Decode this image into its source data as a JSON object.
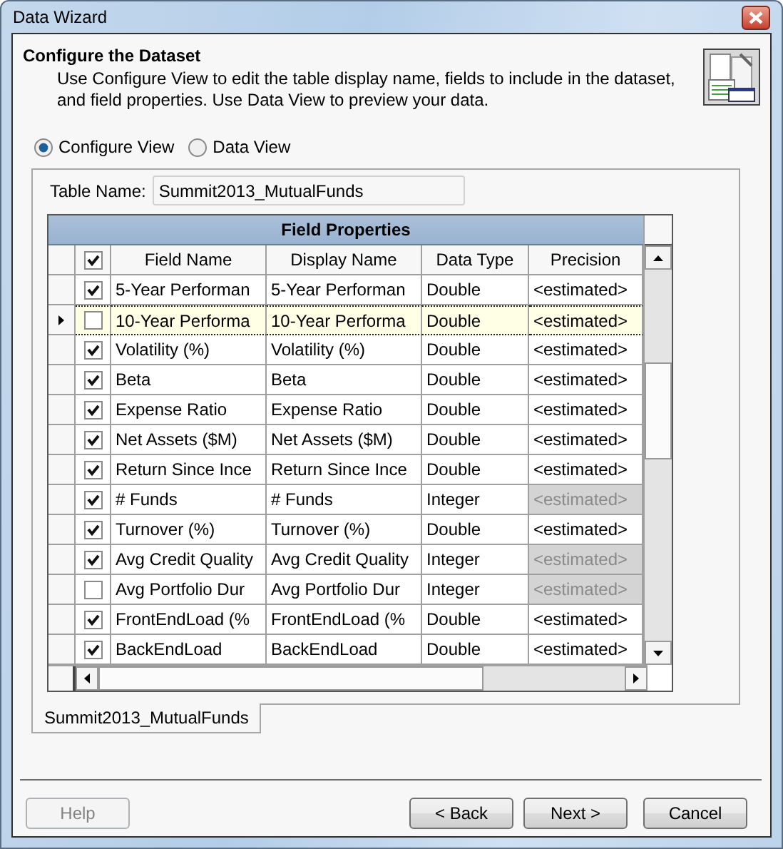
{
  "window": {
    "title": "Data Wizard"
  },
  "header": {
    "title": "Configure the Dataset",
    "description": "Use Configure View to edit the table display name, fields to include in the dataset, and field properties.  Use Data View to preview your data."
  },
  "views": [
    {
      "label": "Configure View",
      "selected": true
    },
    {
      "label": "Data View",
      "selected": false
    }
  ],
  "table_name": {
    "label": "Table Name:",
    "value": "Summit2013_MutualFunds"
  },
  "grid": {
    "title": "Field Properties",
    "all_checked": true,
    "columns": [
      "Field Name",
      "Display Name",
      "Data Type",
      "Precision"
    ],
    "rows": [
      {
        "current": false,
        "checked": true,
        "field_name": "5-Year Performan",
        "display_name": "5-Year Performan",
        "data_type": "Double",
        "precision": "<estimated>",
        "precision_disabled": false
      },
      {
        "current": true,
        "checked": false,
        "field_name": "10-Year Performa",
        "display_name": "10-Year Performa",
        "data_type": "Double",
        "precision": "<estimated>",
        "precision_disabled": false
      },
      {
        "current": false,
        "checked": true,
        "field_name": "Volatility (%)",
        "display_name": "Volatility (%)",
        "data_type": "Double",
        "precision": "<estimated>",
        "precision_disabled": false
      },
      {
        "current": false,
        "checked": true,
        "field_name": "Beta",
        "display_name": "Beta",
        "data_type": "Double",
        "precision": "<estimated>",
        "precision_disabled": false
      },
      {
        "current": false,
        "checked": true,
        "field_name": "Expense Ratio",
        "display_name": "Expense Ratio",
        "data_type": "Double",
        "precision": "<estimated>",
        "precision_disabled": false
      },
      {
        "current": false,
        "checked": true,
        "field_name": "Net Assets ($M)",
        "display_name": "Net Assets ($M)",
        "data_type": "Double",
        "precision": "<estimated>",
        "precision_disabled": false
      },
      {
        "current": false,
        "checked": true,
        "field_name": "Return Since Ince",
        "display_name": "Return Since Ince",
        "data_type": "Double",
        "precision": "<estimated>",
        "precision_disabled": false
      },
      {
        "current": false,
        "checked": true,
        "field_name": "# Funds",
        "display_name": "# Funds",
        "data_type": "Integer",
        "precision": "<estimated>",
        "precision_disabled": true
      },
      {
        "current": false,
        "checked": true,
        "field_name": "Turnover (%)",
        "display_name": "Turnover (%)",
        "data_type": "Double",
        "precision": "<estimated>",
        "precision_disabled": false
      },
      {
        "current": false,
        "checked": true,
        "field_name": "Avg Credit Quality",
        "display_name": "Avg Credit Quality",
        "data_type": "Integer",
        "precision": "<estimated>",
        "precision_disabled": true
      },
      {
        "current": false,
        "checked": false,
        "field_name": "Avg Portfolio Dur",
        "display_name": "Avg Portfolio Dur",
        "data_type": "Integer",
        "precision": "<estimated>",
        "precision_disabled": true
      },
      {
        "current": false,
        "checked": true,
        "field_name": "FrontEndLoad (%",
        "display_name": "FrontEndLoad (%",
        "data_type": "Double",
        "precision": "<estimated>",
        "precision_disabled": false
      },
      {
        "current": false,
        "checked": true,
        "field_name": "BackEndLoad",
        "display_name": "BackEndLoad",
        "data_type": "Double",
        "precision": "<estimated>",
        "precision_disabled": false
      }
    ]
  },
  "tabs": [
    {
      "label": "Summit2013_MutualFunds"
    }
  ],
  "buttons": [
    {
      "label": "Help",
      "disabled": true
    },
    {
      "label": "< Back",
      "disabled": false
    },
    {
      "label": "Next >",
      "disabled": false
    },
    {
      "label": "Cancel",
      "disabled": false
    }
  ]
}
